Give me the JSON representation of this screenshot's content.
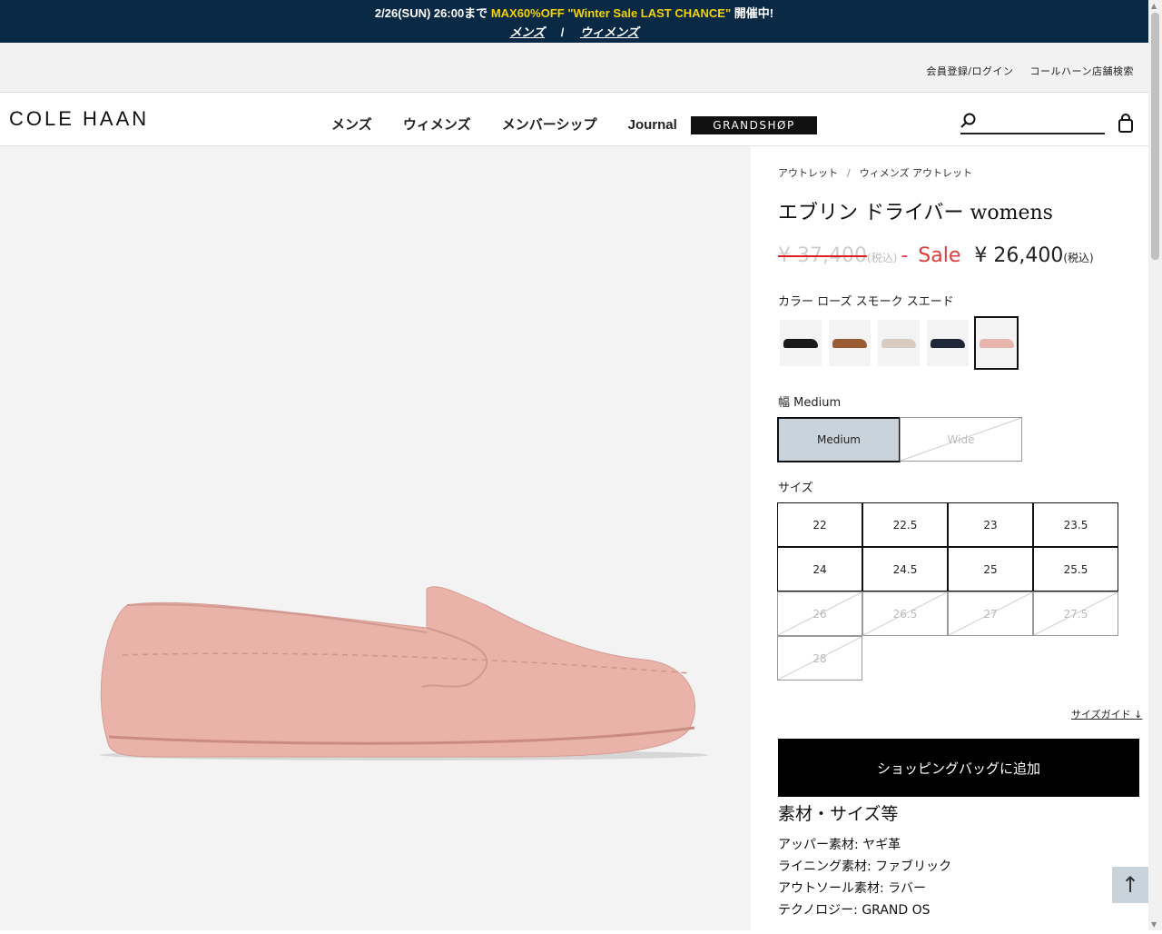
{
  "promo": {
    "prefix": "2/26(SUN) 26:00まで",
    "highlight": "MAX60%OFF \"Winter Sale LAST CHANCE\"",
    "suffix": "開催中!",
    "link_men": "メンズ",
    "separator": "/",
    "link_women": "ウィメンズ"
  },
  "utility": {
    "login": "会員登録/ログイン",
    "store_search": "コールハーン店舗検索"
  },
  "header": {
    "logo": "COLE HAAN",
    "nav": [
      "メンズ",
      "ウィメンズ",
      "メンバーシップ",
      "Journal"
    ],
    "grandshop": "GRANDSHØP",
    "search_placeholder": ""
  },
  "breadcrumb": [
    "アウトレット",
    "ウィメンズ アウトレット"
  ],
  "breadcrumb_sep": "/",
  "product": {
    "title": "エブリン ドライバー womens",
    "original_price": "¥ 37,400",
    "original_tax": "(税込)",
    "dash": "-",
    "sale_label": "Sale",
    "sale_price": "¥ 26,400",
    "sale_tax": "(税込)",
    "color_label": "カラー ローズ スモーク スエード",
    "swatches": [
      {
        "color": "#1a1a1a"
      },
      {
        "color": "#9a5a32"
      },
      {
        "color": "#d8ccc0"
      },
      {
        "color": "#1f2838"
      },
      {
        "color": "#e8b5ac"
      }
    ],
    "width_label": "幅 Medium",
    "widths": [
      "Medium",
      "Wide"
    ],
    "size_label": "サイズ",
    "sizes": [
      {
        "v": "22",
        "ok": true
      },
      {
        "v": "22.5",
        "ok": true
      },
      {
        "v": "23",
        "ok": true
      },
      {
        "v": "23.5",
        "ok": true
      },
      {
        "v": "24",
        "ok": true
      },
      {
        "v": "24.5",
        "ok": true
      },
      {
        "v": "25",
        "ok": true
      },
      {
        "v": "25.5",
        "ok": true
      },
      {
        "v": "26",
        "ok": false
      },
      {
        "v": "26.5",
        "ok": false
      },
      {
        "v": "27",
        "ok": false
      },
      {
        "v": "27.5",
        "ok": false
      },
      {
        "v": "28",
        "ok": false
      }
    ],
    "size_guide": "サイズガイド ↓",
    "add_to_bag": "ショッピングバッグに追加",
    "materials_title": "素材・サイズ等",
    "materials": [
      "アッパー素材: ヤギ革",
      "ライニング素材: ファブリック",
      "アウトソール素材: ラバー",
      "テクノロジー: GRAND OS"
    ]
  },
  "back_to_top": "↑"
}
